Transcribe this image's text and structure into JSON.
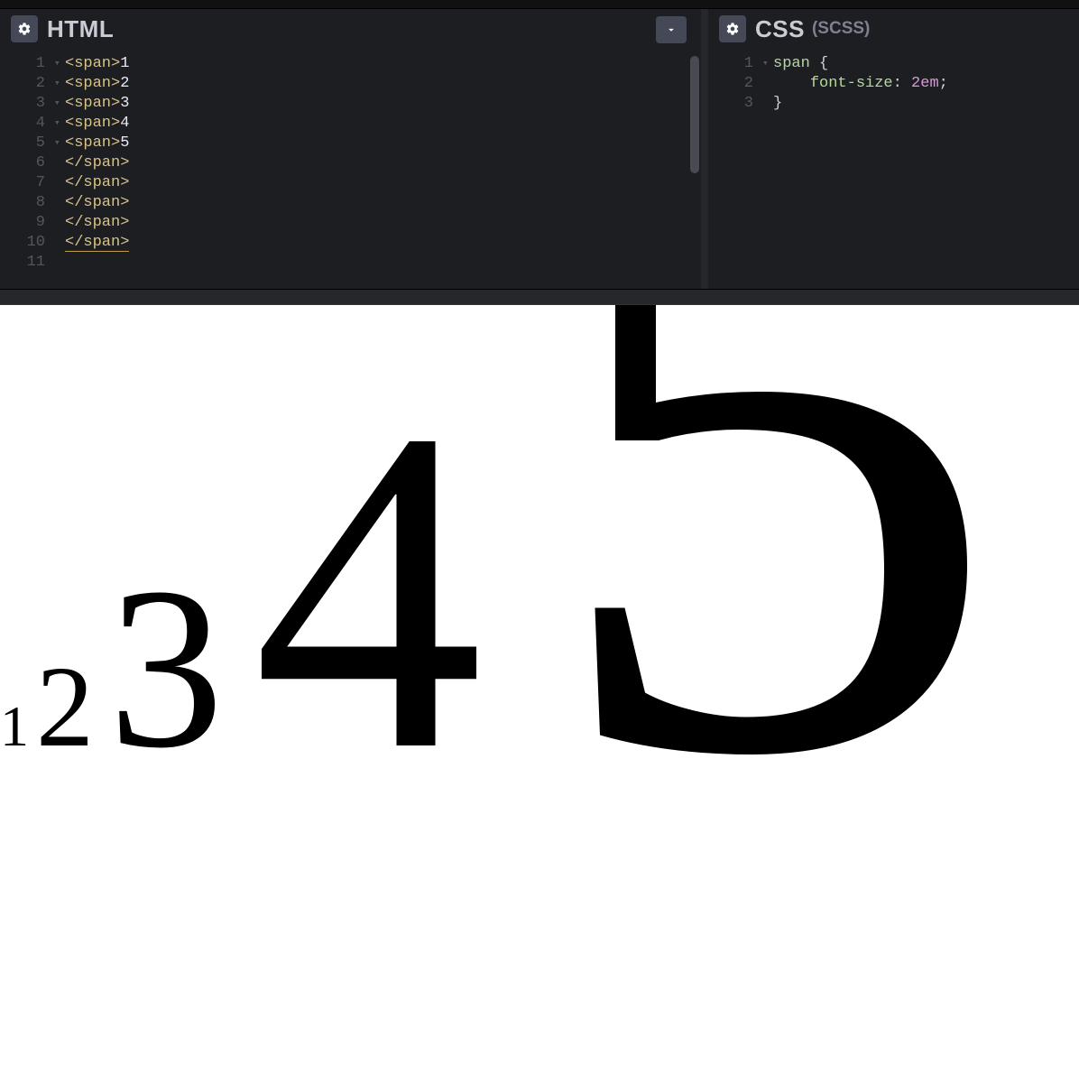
{
  "panels": {
    "html": {
      "title": "HTML",
      "lines": [
        {
          "num": "1",
          "fold": "▾",
          "tag_open": "<span>",
          "text": "1"
        },
        {
          "num": "2",
          "fold": "▾",
          "tag_open": "<span>",
          "text": "2"
        },
        {
          "num": "3",
          "fold": "▾",
          "tag_open": "<span>",
          "text": "3"
        },
        {
          "num": "4",
          "fold": "▾",
          "tag_open": "<span>",
          "text": "4"
        },
        {
          "num": "5",
          "fold": "▾",
          "tag_open": "<span>",
          "text": "5"
        },
        {
          "num": "6",
          "fold": "",
          "tag_close": "</span>"
        },
        {
          "num": "7",
          "fold": "",
          "tag_close": "</span>"
        },
        {
          "num": "8",
          "fold": "",
          "tag_close": "</span>"
        },
        {
          "num": "9",
          "fold": "",
          "tag_close": "</span>"
        },
        {
          "num": "10",
          "fold": "",
          "tag_close": "</span>",
          "underline": true
        },
        {
          "num": "11",
          "fold": "",
          "blank": true
        }
      ]
    },
    "css": {
      "title": "CSS",
      "subtitle": "(SCSS)",
      "lines": [
        {
          "num": "1",
          "fold": "▾",
          "selector": "span",
          "brace_open": " {"
        },
        {
          "num": "2",
          "fold": "",
          "indent": "    ",
          "prop": "font-size",
          "colon": ": ",
          "value": "2em",
          "semi": ";"
        },
        {
          "num": "3",
          "fold": "",
          "brace_close": "}"
        }
      ]
    }
  },
  "output": {
    "digits": [
      "1",
      "2",
      "3",
      "4",
      "5"
    ]
  }
}
